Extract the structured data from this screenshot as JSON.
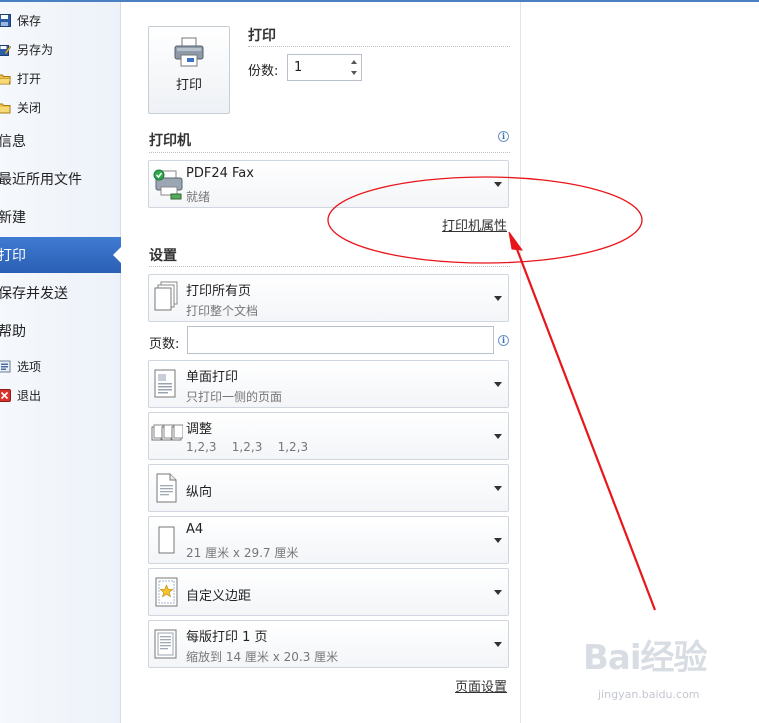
{
  "sidebar": {
    "small_top": [
      {
        "label": "保存",
        "icon": "save-icon"
      },
      {
        "label": "另存为",
        "icon": "save-as-icon"
      },
      {
        "label": "打开",
        "icon": "open-folder-icon"
      },
      {
        "label": "关闭",
        "icon": "close-folder-icon"
      }
    ],
    "big": [
      {
        "label": "信息"
      },
      {
        "label": "最近所用文件"
      },
      {
        "label": "新建"
      },
      {
        "label": "打印",
        "active": true
      },
      {
        "label": "保存并发送"
      },
      {
        "label": "帮助"
      }
    ],
    "small_bottom": [
      {
        "label": "选项",
        "icon": "options-icon"
      },
      {
        "label": "退出",
        "icon": "exit-icon"
      }
    ]
  },
  "print": {
    "heading": "打印",
    "button_label": "打印",
    "copies_label": "份数:",
    "copies_value": "1"
  },
  "printer": {
    "heading": "打印机",
    "name": "PDF24 Fax",
    "status": "就绪",
    "properties_link": "打印机属性"
  },
  "settings": {
    "heading": "设置",
    "pages_label": "页数:",
    "pages_value": "",
    "options": [
      {
        "title": "打印所有页",
        "subtitle": "打印整个文档",
        "icon": "all-pages-icon"
      },
      {
        "title": "单面打印",
        "subtitle": "只打印一侧的页面",
        "icon": "one-sided-icon"
      },
      {
        "title": "调整",
        "subtitle": "1,2,3    1,2,3    1,2,3",
        "icon": "collate-icon"
      },
      {
        "title": "纵向",
        "subtitle": "",
        "icon": "portrait-icon"
      },
      {
        "title": "A4",
        "subtitle": "21 厘米 x 29.7 厘米",
        "icon": "paper-size-icon"
      },
      {
        "title": "自定义边距",
        "subtitle": "",
        "icon": "custom-margins-icon"
      },
      {
        "title": "每版打印 1 页",
        "subtitle": "缩放到 14 厘米 x 20.3 厘米",
        "icon": "pages-per-sheet-icon"
      }
    ],
    "page_setup_link": "页面设置"
  },
  "watermark": {
    "text": "Bai经验",
    "url": "jingyan.baidu.com"
  },
  "colors": {
    "accent": "#2a5fb5",
    "annotation": "#e8161b"
  }
}
